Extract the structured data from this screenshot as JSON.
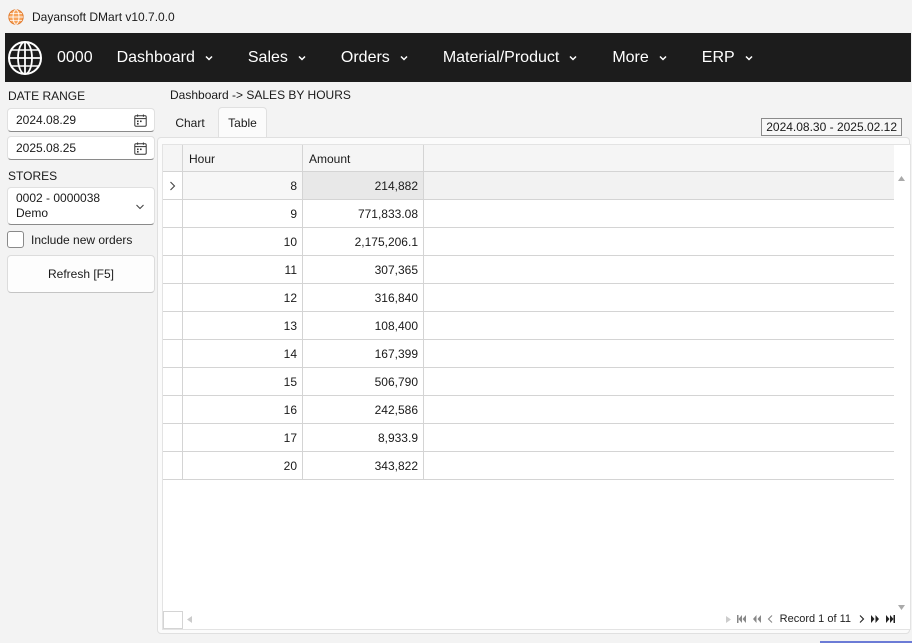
{
  "window": {
    "title": "Dayansoft DMart v10.7.0.0"
  },
  "nav": {
    "code": "0000",
    "items": [
      {
        "id": "dashboard",
        "label": "Dashboard"
      },
      {
        "id": "sales",
        "label": "Sales"
      },
      {
        "id": "orders",
        "label": "Orders"
      },
      {
        "id": "material",
        "label": "Material/Product"
      },
      {
        "id": "more",
        "label": "More"
      },
      {
        "id": "erp",
        "label": "ERP"
      }
    ]
  },
  "sidebar": {
    "date_range_label": "DATE RANGE",
    "date_from": "2024.08.29",
    "date_to": "2025.08.25",
    "stores_label": "STORES",
    "store_line1": "0002 - 0000038",
    "store_line2": "Demo",
    "include_new_orders_label": "Include new orders",
    "include_new_orders_checked": false,
    "refresh_label": "Refresh [F5]"
  },
  "main": {
    "breadcrumb": "Dashboard -> SALES BY HOURS",
    "tabs": [
      {
        "id": "chart",
        "label": "Chart",
        "active": false
      },
      {
        "id": "table",
        "label": "Table",
        "active": true
      }
    ],
    "range_badge": "2024.08.30 - 2025.02.12"
  },
  "table": {
    "columns": [
      "Hour",
      "Amount"
    ],
    "rows": [
      {
        "hour": "8",
        "amount": "214,882"
      },
      {
        "hour": "9",
        "amount": "771,833.08"
      },
      {
        "hour": "10",
        "amount": "2,175,206.1"
      },
      {
        "hour": "11",
        "amount": "307,365"
      },
      {
        "hour": "12",
        "amount": "316,840"
      },
      {
        "hour": "13",
        "amount": "108,400"
      },
      {
        "hour": "14",
        "amount": "167,399"
      },
      {
        "hour": "15",
        "amount": "506,790"
      },
      {
        "hour": "16",
        "amount": "242,586"
      },
      {
        "hour": "17",
        "amount": "8,933.9"
      },
      {
        "hour": "20",
        "amount": "343,822"
      }
    ],
    "selected_row": 0,
    "record_text": "Record 1 of 11"
  },
  "colors": {
    "navbar": "#1c1c1c",
    "accent": "#6c7bd6",
    "app_icon": "#f08a3c"
  }
}
